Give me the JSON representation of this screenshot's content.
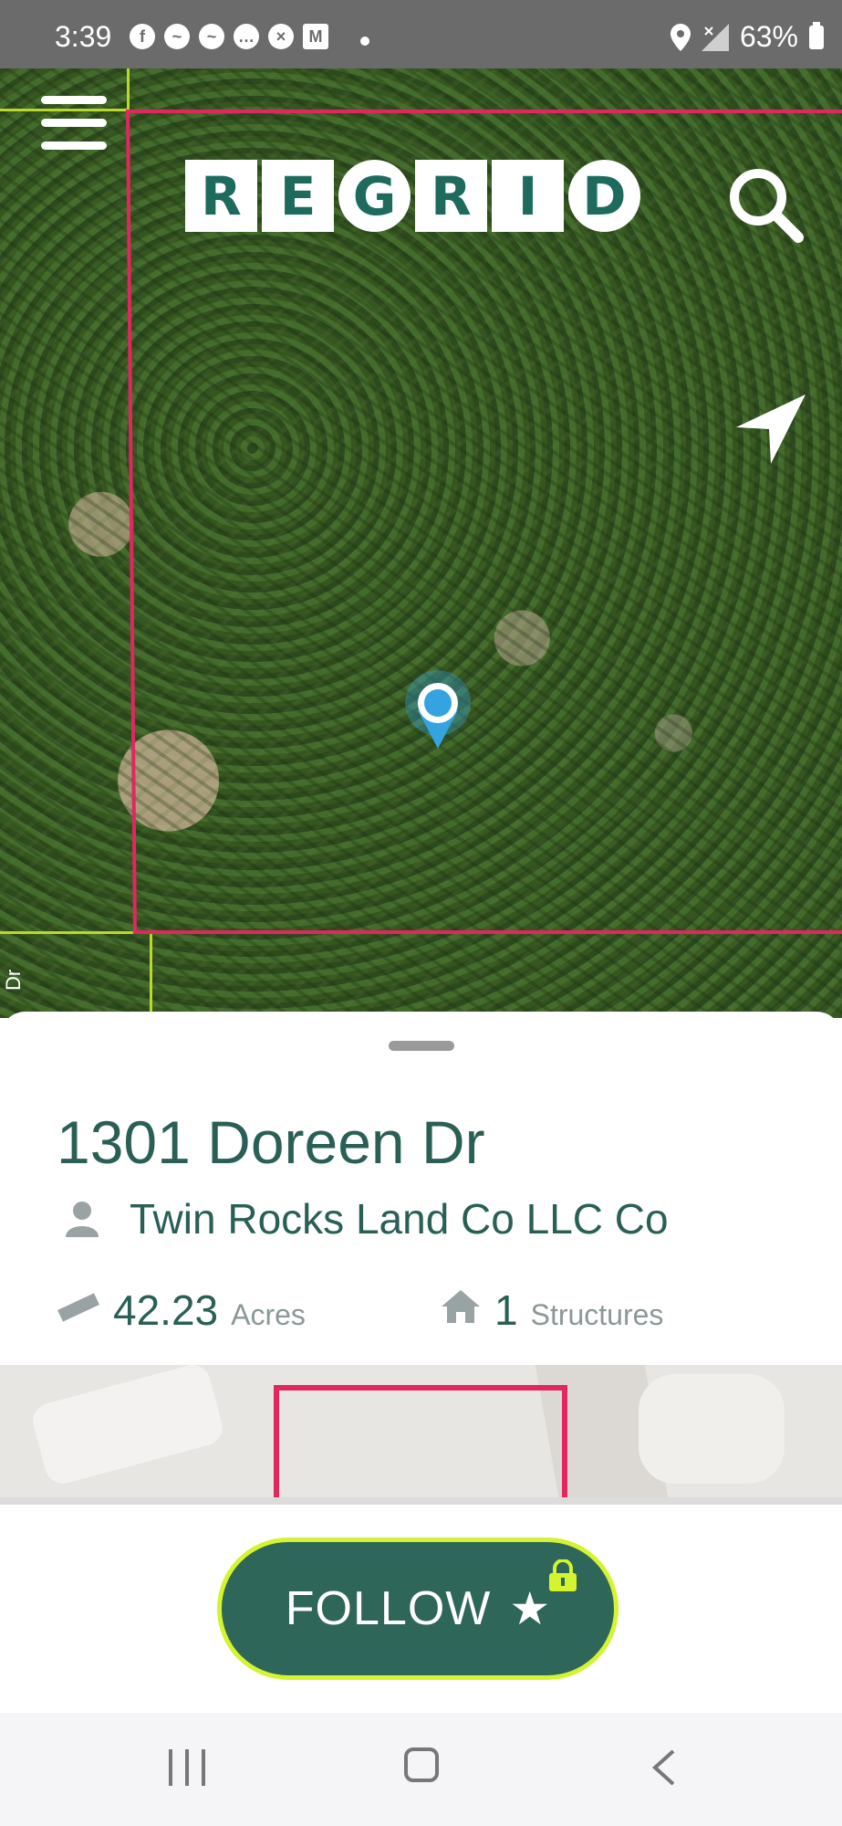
{
  "status_bar": {
    "time": "3:39",
    "battery": "63%"
  },
  "header": {
    "menu_icon": "menu-icon",
    "logo_letters": [
      "R",
      "E",
      "G",
      "R",
      "I",
      "D"
    ],
    "search_icon": "search-icon"
  },
  "map": {
    "road_label": "Dr",
    "parcel_color": "#e2275f",
    "neighbor_line_color": "#b9d92a",
    "location_icon": "navigation-arrow-icon",
    "pin_color": "#34a3e0"
  },
  "parcel": {
    "address": "1301 Doreen Dr",
    "owner": "Twin Rocks Land Co LLC Co",
    "acres_value": "42.23",
    "acres_unit": "Acres",
    "structures_value": "1",
    "structures_unit": "Structures"
  },
  "follow_button": {
    "label": "FOLLOW",
    "star": "★",
    "accent": "#d3f42f",
    "background": "#2e6659"
  }
}
